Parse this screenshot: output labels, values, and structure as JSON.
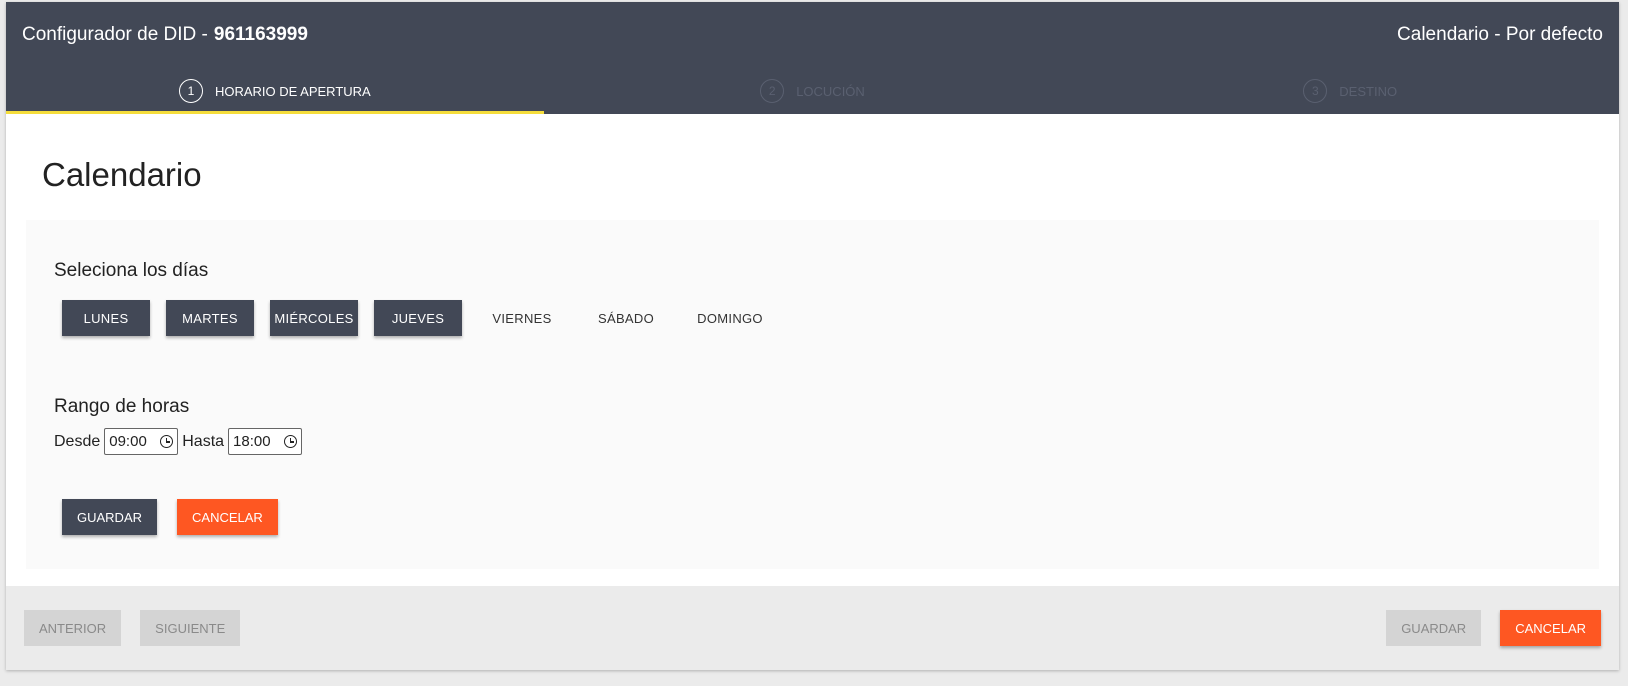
{
  "header": {
    "title_prefix": "Configurador de DID -",
    "did_number": "961163999",
    "calendar_label": "Calendario - Por defecto"
  },
  "stepper": {
    "steps": [
      {
        "number": "1",
        "label": "HORARIO DE APERTURA",
        "state": "active"
      },
      {
        "number": "2",
        "label": "LOCUCIÓN",
        "state": "disabled"
      },
      {
        "number": "3",
        "label": "DESTINO",
        "state": "disabled"
      }
    ]
  },
  "page": {
    "title": "Calendario"
  },
  "days_section": {
    "label": "Seleciona los días",
    "days": [
      {
        "label": "LUNES",
        "selected": true
      },
      {
        "label": "MARTES",
        "selected": true
      },
      {
        "label": "MIÉRCOLES",
        "selected": true
      },
      {
        "label": "JUEVES",
        "selected": true
      },
      {
        "label": "VIERNES",
        "selected": false
      },
      {
        "label": "SÁBADO",
        "selected": false
      },
      {
        "label": "DOMINGO",
        "selected": false
      }
    ]
  },
  "range_section": {
    "label": "Rango de horas",
    "from_label": "Desde",
    "from_value": "09:00",
    "to_label": "Hasta",
    "to_value": "18:00"
  },
  "panel_actions": {
    "save_label": "GUARDAR",
    "cancel_label": "CANCELAR"
  },
  "footer": {
    "prev_label": "ANTERIOR",
    "next_label": "SIGUIENTE",
    "save_label": "GUARDAR",
    "cancel_label": "CANCELAR"
  },
  "colors": {
    "header_bg": "#424856",
    "accent_yellow": "#f5dd3c",
    "orange": "#fe5722",
    "disabled_grey": "#d4d4d4"
  }
}
